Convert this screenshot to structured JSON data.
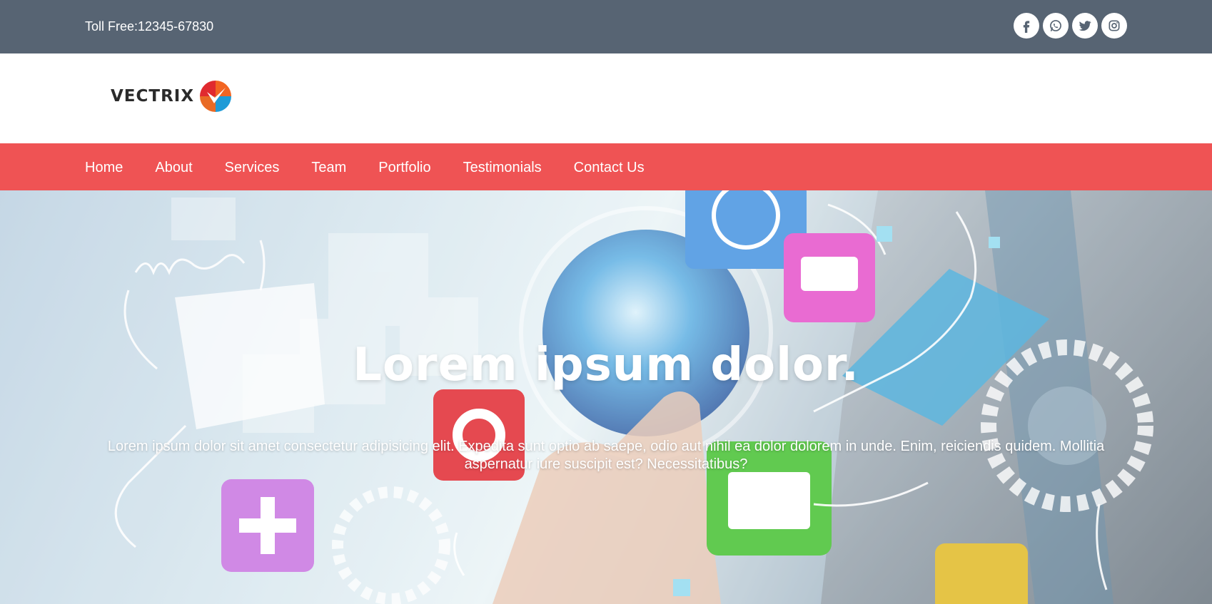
{
  "topbar": {
    "toll_free": "Toll Free:12345-67830",
    "socials": [
      "facebook-icon",
      "whatsapp-icon",
      "twitter-icon",
      "instagram-icon"
    ]
  },
  "logo": {
    "text": "VECTRIX",
    "icon": "vectrix-logo-mark"
  },
  "nav": {
    "items": [
      {
        "label": "Home"
      },
      {
        "label": "About"
      },
      {
        "label": "Services"
      },
      {
        "label": "Team"
      },
      {
        "label": "Portfolio"
      },
      {
        "label": "Testimonials"
      },
      {
        "label": "Contact Us"
      }
    ]
  },
  "hero": {
    "title": "Lorem ipsum dolor.",
    "text": "Lorem ipsum dolor sit amet consectetur adipisicing elit. Expedita sunt optio ab saepe, odio aut nihil ea dolor dolorem in unde. Enim, reiciendis quidem. Mollitia aspernatur iure suscipit est? Necessitatibus?"
  },
  "colors": {
    "topbar": "#576473",
    "nav": "#ef5354",
    "text_light": "#ffffff",
    "logo_orange": "#f26522",
    "logo_red": "#e02a2f",
    "logo_blue": "#1f9bd7"
  }
}
